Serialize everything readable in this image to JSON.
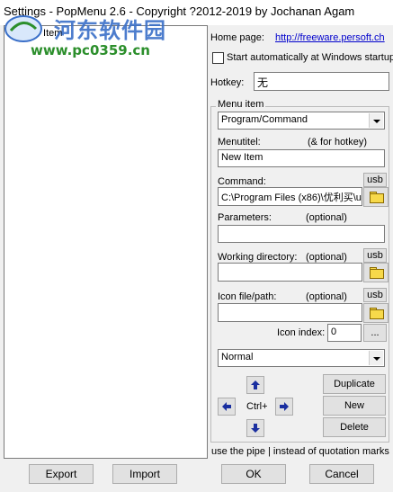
{
  "window": {
    "title": "Settings - PopMenu 2.6 - Copyright ?2012-2019 by Jochanan Agam"
  },
  "watermark": {
    "line1": "河东软件园",
    "line2": "www.pc0359.cn"
  },
  "tree": {
    "items": [
      {
        "label": "New Item"
      }
    ]
  },
  "homepage": {
    "label": "Home page:",
    "url": "http://freeware.persoft.ch"
  },
  "startup": {
    "label": "Start automatically at Windows startup",
    "checked": false
  },
  "hotkey": {
    "label": "Hotkey:",
    "value": "无"
  },
  "menu_item": {
    "group_title": "Menu item",
    "type_value": "Program/Command",
    "menutitel_label": "Menutitel:",
    "menutitel_hint": "(& for hotkey)",
    "menutitel_value": "New Item",
    "command_label": "Command:",
    "command_value": "C:\\Program Files (x86)\\优利买\\u",
    "usb_label": "usb",
    "parameters_label": "Parameters:",
    "optional": "(optional)",
    "parameters_value": "",
    "workdir_label": "Working directory:",
    "workdir_value": "",
    "icon_label": "Icon file/path:",
    "icon_value": "",
    "icon_index_label": "Icon index:",
    "icon_index_value": "0",
    "ellipsis": "...",
    "window_state": "Normal",
    "ctrl_label": "Ctrl+",
    "duplicate": "Duplicate",
    "new": "New",
    "delete": "Delete"
  },
  "hint": "use the pipe | instead of quotation marks !",
  "buttons": {
    "export": "Export",
    "import": "Import",
    "ok": "OK",
    "cancel": "Cancel"
  }
}
